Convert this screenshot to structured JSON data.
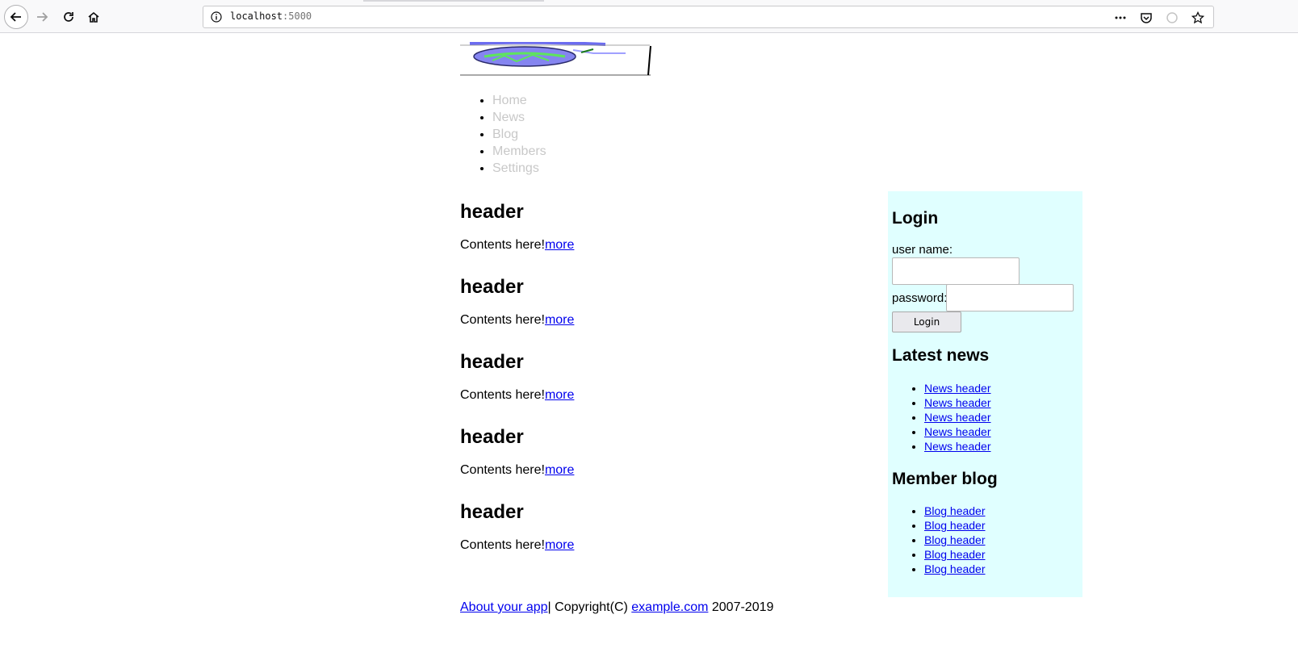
{
  "browser": {
    "url_host": "localhost",
    "url_port": ":5000"
  },
  "nav": {
    "items": [
      "Home",
      "News",
      "Blog",
      "Members",
      "Settings"
    ]
  },
  "posts": [
    {
      "header": "header",
      "content": "Contents here!",
      "more": "more"
    },
    {
      "header": "header",
      "content": "Contents here!",
      "more": "more"
    },
    {
      "header": "header",
      "content": "Contents here!",
      "more": "more"
    },
    {
      "header": "header",
      "content": "Contents here!",
      "more": "more"
    },
    {
      "header": "header",
      "content": "Contents here!",
      "more": "more"
    }
  ],
  "login": {
    "title": "Login",
    "username_label": "user name:",
    "password_label": "password:",
    "username_value": "",
    "password_value": "",
    "button": "Login"
  },
  "latest_news": {
    "title": "Latest news",
    "items": [
      "News header",
      "News header",
      "News header",
      "News header",
      "News header"
    ]
  },
  "member_blog": {
    "title": "Member blog",
    "items": [
      "Blog header",
      "Blog header",
      "Blog header",
      "Blog header",
      "Blog header"
    ]
  },
  "footer": {
    "about": "About your app",
    "copyright": "| Copyright(C) ",
    "site": "example.com",
    "years": " 2007-2019"
  },
  "colors": {
    "sidebar_bg": "#e0ffff",
    "nav_link": "#c8c8c8",
    "link": "#0000ee"
  }
}
